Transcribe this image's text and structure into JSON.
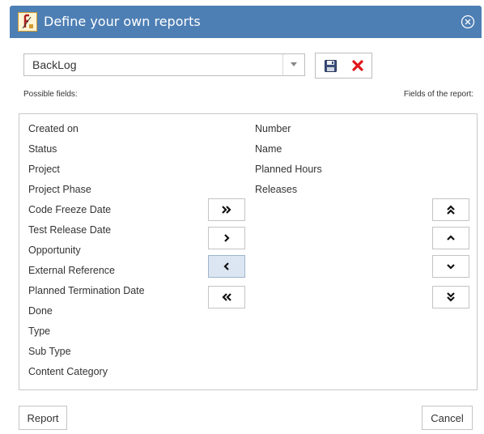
{
  "dialog": {
    "title": "Define your own reports"
  },
  "report_select": {
    "selected": "BackLog"
  },
  "labels": {
    "possible_fields": "Possible fields:",
    "report_fields": "Fields of the report:"
  },
  "possible_fields": [
    "Created on",
    "Status",
    "Project",
    "Project Phase",
    "Code Freeze Date",
    "Test Release Date",
    "Opportunity",
    "External Reference",
    "Planned Termination Date",
    "Done",
    "Type",
    "Sub Type",
    "Content Category"
  ],
  "report_fields": [
    "Number",
    "Name",
    "Planned Hours",
    "Releases"
  ],
  "buttons": {
    "report": "Report",
    "cancel": "Cancel"
  },
  "icons": {
    "app": "report-app-icon",
    "close": "close-circle-icon",
    "save": "floppy-disk-icon",
    "delete": "red-x-icon",
    "add_all": "double-chevron-right-icon",
    "add": "chevron-right-icon",
    "remove": "chevron-left-icon",
    "remove_all": "double-chevron-left-icon",
    "move_top": "double-chevron-up-icon",
    "move_up": "chevron-up-icon",
    "move_down": "chevron-down-icon",
    "move_bottom": "double-chevron-down-icon"
  },
  "colors": {
    "titlebar": "#4e7fb4",
    "delete": "#e0161b"
  }
}
